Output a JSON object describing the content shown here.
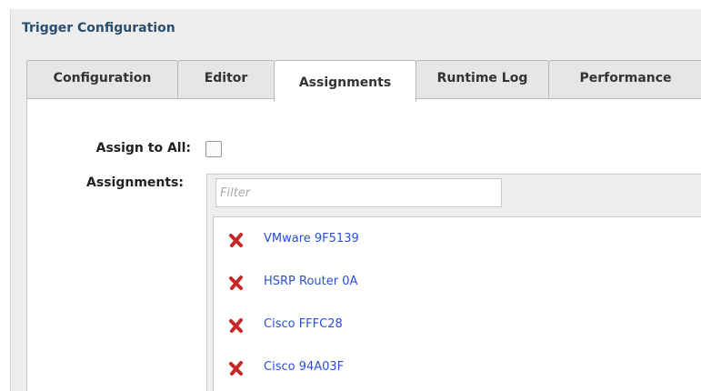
{
  "panel": {
    "title": "Trigger Configuration"
  },
  "tabs": [
    {
      "label": "Configuration",
      "active": false
    },
    {
      "label": "Editor",
      "active": false
    },
    {
      "label": "Assignments",
      "active": true
    },
    {
      "label": "Runtime Log",
      "active": false
    },
    {
      "label": "Performance",
      "active": false
    }
  ],
  "form": {
    "assign_all_label": "Assign to All:",
    "assign_all_checked": false,
    "assignments_label": "Assignments:",
    "filter_placeholder": "Filter",
    "filter_value": ""
  },
  "assignments": [
    {
      "name": "VMware 9F5139"
    },
    {
      "name": "HSRP Router 0A"
    },
    {
      "name": "Cisco FFFC28"
    },
    {
      "name": "Cisco 94A03F"
    }
  ],
  "colors": {
    "title": "#2b4e6e",
    "link": "#2a4fd6",
    "remove_icon": "#c62828"
  },
  "icons": {
    "remove": "red-x-remove-icon"
  }
}
